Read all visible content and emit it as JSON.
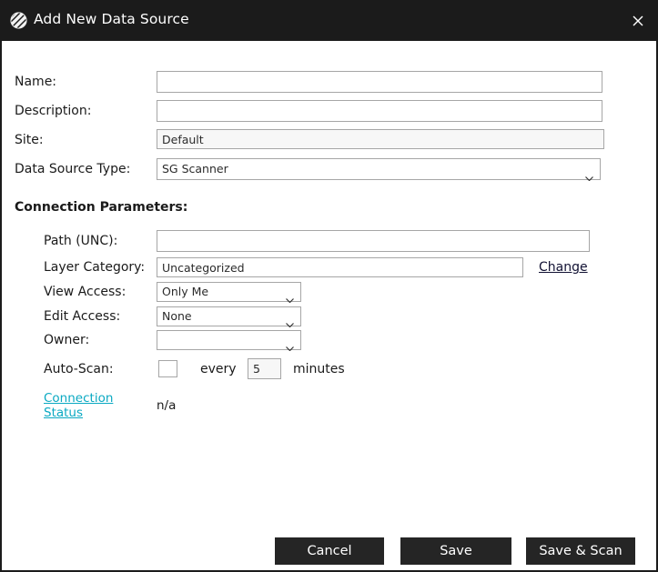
{
  "window": {
    "title": "Add New Data Source",
    "app_icon": "globe-icon",
    "close_icon": "close-icon",
    "titlebar_color": "#1b1b1b"
  },
  "form": {
    "name": {
      "label": "Name:",
      "value": "",
      "placeholder": ""
    },
    "description": {
      "label": "Description:",
      "value": "",
      "placeholder": ""
    },
    "site": {
      "label": "Site:",
      "value": "Default",
      "readonly": true
    },
    "data_source_type": {
      "label": "Data Source Type:",
      "value": "SG Scanner",
      "options": [
        "SG Scanner"
      ]
    }
  },
  "connection_parameters": {
    "heading": "Connection Parameters:",
    "path": {
      "label": "Path (UNC):",
      "value": "",
      "placeholder": ""
    },
    "layer_category": {
      "label": "Layer Category:",
      "value": "Uncategorized"
    },
    "change_link": "Change",
    "view_access": {
      "label": "View Access:",
      "value": "Only Me",
      "options": [
        "Only Me"
      ]
    },
    "edit_access": {
      "label": "Edit Access:",
      "value": "None",
      "options": [
        "None"
      ]
    },
    "owner": {
      "label": "Owner:",
      "value": "",
      "options": []
    },
    "auto_scan": {
      "label": "Auto-Scan:",
      "checked": false,
      "every_label": "every",
      "interval_value": "5",
      "units_label": "minutes"
    },
    "connection_status": {
      "link_line1": "Connection",
      "link_line2": "Status",
      "value": "n/a",
      "link_color": "#0aa9c2"
    }
  },
  "footer": {
    "cancel_label": "Cancel",
    "save_label": "Save",
    "save_scan_label": "Save & Scan",
    "button_color": "#252525"
  }
}
